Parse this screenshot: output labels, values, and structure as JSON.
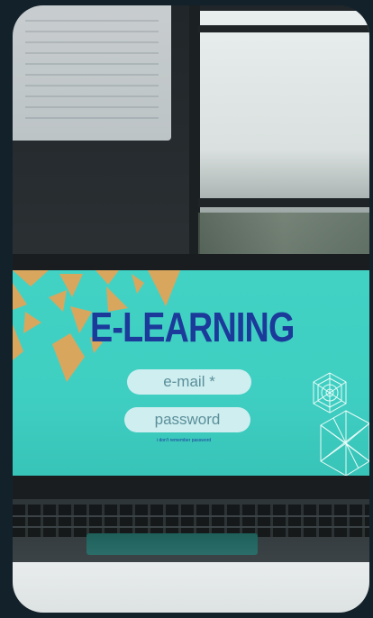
{
  "screen": {
    "title": "E-LEARNING",
    "email_placeholder": "e-mail *",
    "password_placeholder": "password",
    "forgot_link": "i don't remember password"
  },
  "colors": {
    "screen_teal": "#42d2c4",
    "title_blue": "#1b3a9a",
    "accent_gold": "#d9a65e",
    "field_fill": "#cfeef0"
  },
  "icons": {
    "corner_pattern": "gold-triangles-icon",
    "emblem": "geometric-flower-icon",
    "polyhedron": "wireframe-polyhedron-icon"
  }
}
